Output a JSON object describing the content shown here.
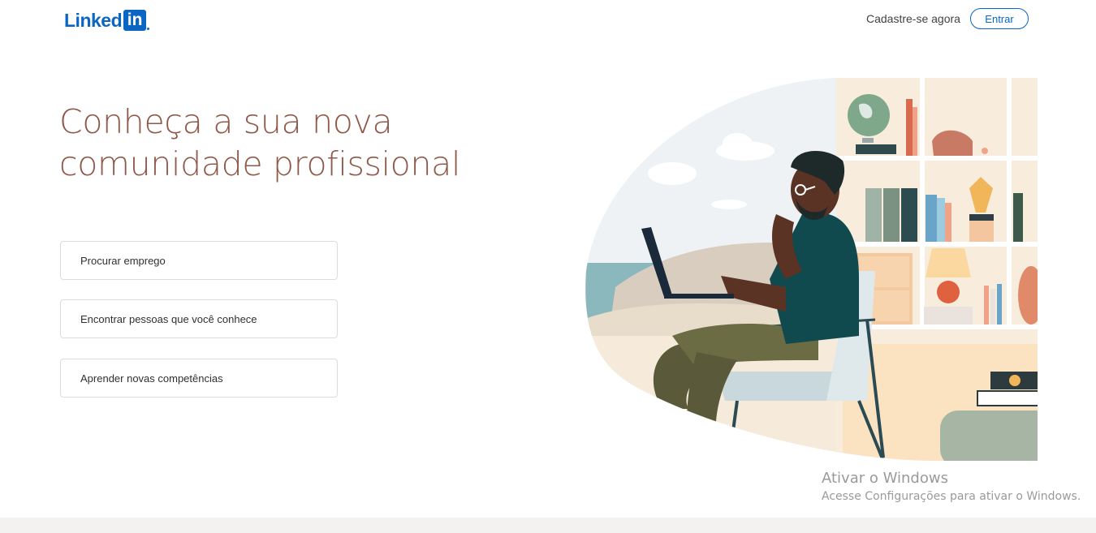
{
  "header": {
    "logo_text": "Linked",
    "logo_box_text": "in",
    "signup_label": "Cadastre-se agora",
    "signin_label": "Entrar"
  },
  "hero": {
    "headline_line1": "Conheça a sua nova",
    "headline_line2": "comunidade profissional"
  },
  "options": [
    {
      "label": "Procurar emprego"
    },
    {
      "label": "Encontrar pessoas que você conhece"
    },
    {
      "label": "Aprender novas competências"
    }
  ],
  "windows_watermark": {
    "title": "Ativar o Windows",
    "subtitle": "Acesse Configurações para ativar o Windows."
  },
  "colors": {
    "brand": "#0a66c2",
    "headline": "#8f5849"
  }
}
